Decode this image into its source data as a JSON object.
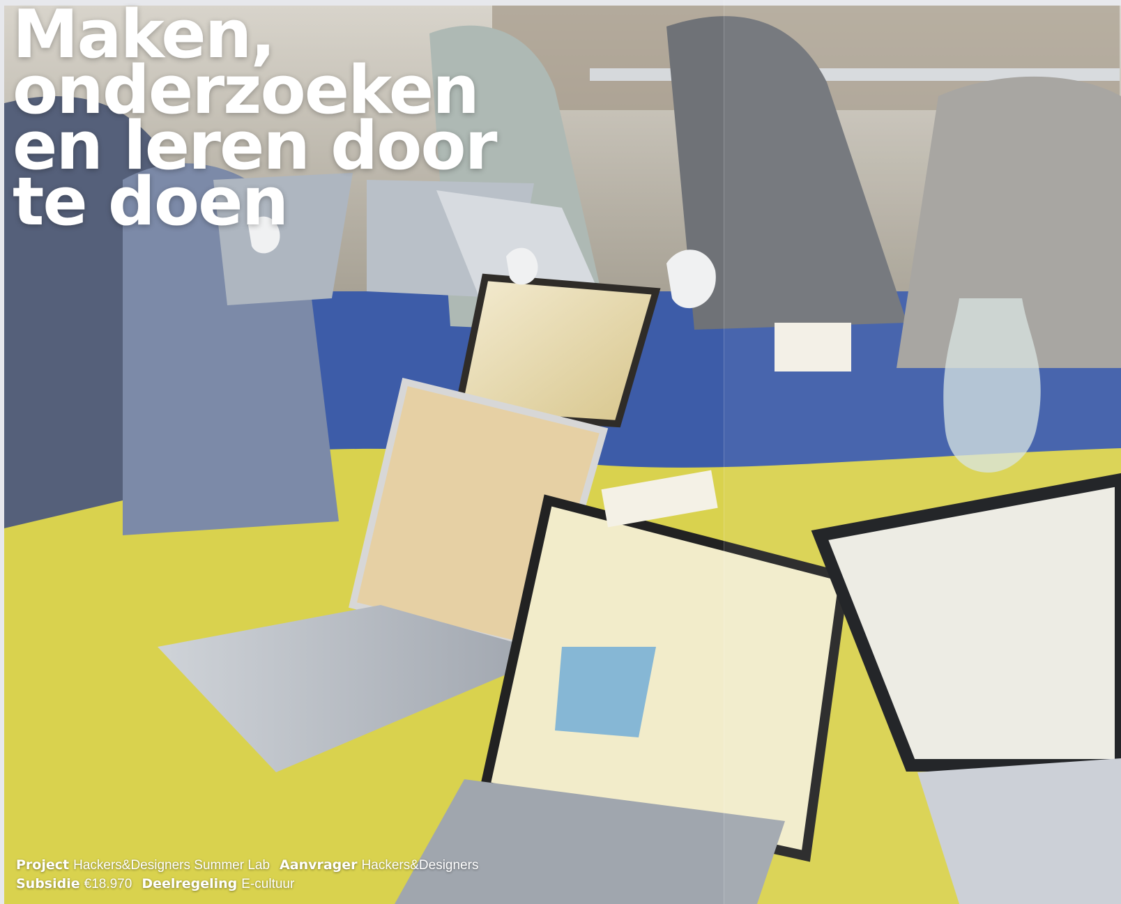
{
  "headline": {
    "line1": "Maken,",
    "line2": "onderzoeken",
    "line3": "en leren door",
    "line4": "te doen"
  },
  "credits": {
    "project_label": "Project",
    "project_value": "Hackers&Designers Summer Lab",
    "aanvrager_label": "Aanvrager",
    "aanvrager_value": "Hackers&Designers",
    "subsidie_label": "Subsidie",
    "subsidie_value": "€18.970",
    "deelregeling_label": "Deelregeling",
    "deelregeling_value": "E-cultuur"
  },
  "colors": {
    "table_blue": "#3c5aa7",
    "table_yellow": "#d9d24e",
    "headline_text": "#ffffff"
  },
  "icons": {
    "apple_logo": "apple-logo-icon"
  }
}
